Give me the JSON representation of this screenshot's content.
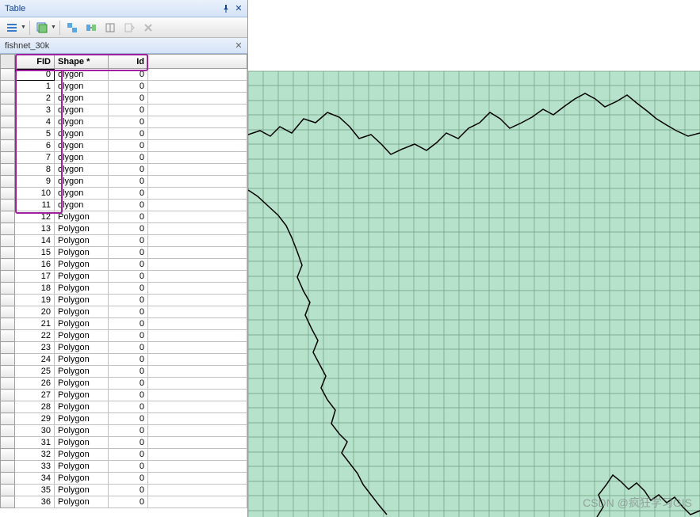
{
  "panel": {
    "title": "Table"
  },
  "tab": {
    "name": "fishnet_30k"
  },
  "table": {
    "columns": [
      "FID",
      "Shape *",
      "Id"
    ],
    "shape_label": "Polygon",
    "shape_label_highlighted": "olygon",
    "id_value": "0",
    "row_count": 37,
    "highlighted_rows": 12
  },
  "toolbar_icons": [
    "list-options",
    "selected-records",
    "swap",
    "related",
    "add-field",
    "export",
    "delete",
    "close"
  ],
  "watermark": "CSDN @疯狂学习GIS"
}
